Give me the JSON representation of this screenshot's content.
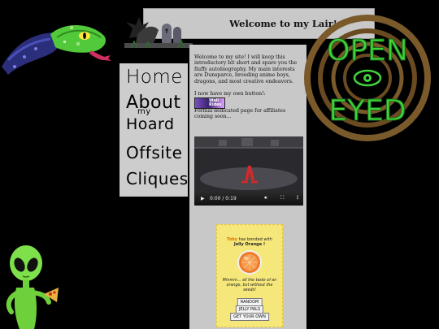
{
  "header": {
    "title": "Welcome to my Lair!"
  },
  "nav": {
    "home": "Home",
    "about": "About",
    "hoard_prefix": "my",
    "hoard": "Hoard",
    "offsite": "Offsite",
    "cliques": "Cliques"
  },
  "main": {
    "intro": "Welcome to my site! I will keep this introductory bit short and spare you the fluffy autobiography. My main interests are Dunsparce, brooding anime boys, dragons, and most creative endeavors.",
    "button_line": "I now have my own button!:",
    "button_text": "Wall Rides",
    "affiliates": "Formal dedicated page for affiliates coming soon..."
  },
  "video": {
    "time": "0:00 / 0:19",
    "play_icon": "play-icon",
    "volume_icon": "volume-icon",
    "fullscreen_icon": "fullscreen-icon",
    "more_icon": "more-options-icon"
  },
  "pet": {
    "name": "Toby",
    "bonded_text": " has bonded with",
    "pet_name": "Jelly Orange !",
    "quote": "Mmmm... all the taste of an orange, but without the seeds!",
    "buttons": [
      "RANDOM",
      "JELLY PALS",
      "GET YOUR OWN"
    ]
  },
  "logo": {
    "line1": "OPEN",
    "line2": "EYED"
  },
  "colors": {
    "panel": "#c8c8c8",
    "logo_green": "#3fd43a",
    "logo_brown": "#7a5a2a",
    "pet_bg": "#f6e77a"
  }
}
